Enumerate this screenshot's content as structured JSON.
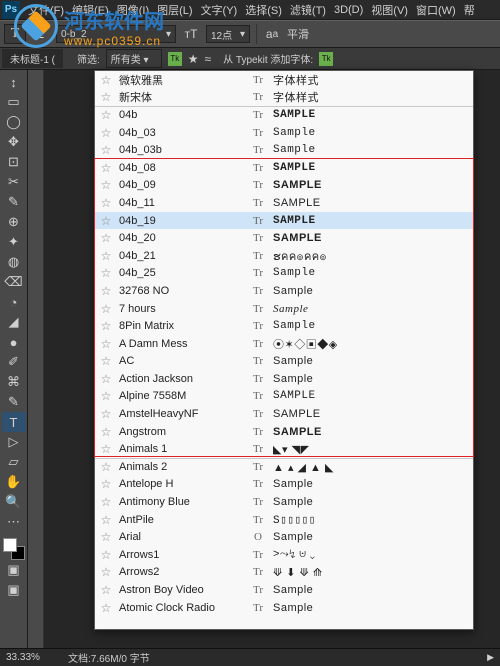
{
  "watermark": {
    "title": "河东软件网",
    "url": "www.pc0359.cn"
  },
  "menubar": {
    "logo": "Ps",
    "items": [
      "文件(F)",
      "编辑(E)",
      "图像(I)",
      "图层(L)",
      "文字(Y)",
      "选择(S)",
      "滤镜(T)",
      "3D(D)",
      "视图(V)",
      "窗口(W)",
      "帮"
    ]
  },
  "optbar": {
    "font_search": "0-b_2",
    "size_label": "12点",
    "aa_label": "平滑"
  },
  "doctab": {
    "title": "未标题-1 (",
    "filter_label": "筛选:",
    "filter_value": "所有类",
    "typekit": "从 Typekit 添加字体:"
  },
  "tools": [
    "↕",
    "▭",
    "◯",
    "✥",
    "⊡",
    "✂",
    "✎",
    "⊕",
    "✦",
    "◍",
    "⌫",
    "◔",
    "◢",
    "●",
    "✐",
    "⌘",
    "✎",
    "T",
    "▷",
    "▱",
    "✋",
    "🔍",
    "⋯"
  ],
  "font_panel": {
    "highlight_start": 5,
    "highlight_end": 22,
    "selected_index": 8,
    "rows": [
      {
        "star": "☆",
        "name": "微软雅黑",
        "type": "Tr",
        "sample": "字体样式",
        "cls": "",
        "sep": false
      },
      {
        "star": "☆",
        "name": "新宋体",
        "type": "Tr",
        "sample": "字体样式",
        "cls": "",
        "sep": false
      },
      {
        "star": "☆",
        "name": "04b",
        "type": "Tr",
        "sample": "Sample",
        "cls": "s-px",
        "sep": true
      },
      {
        "star": "☆",
        "name": "04b_03",
        "type": "Tr",
        "sample": "Sample",
        "cls": "s-mono",
        "sep": false
      },
      {
        "star": "☆",
        "name": "04b_03b",
        "type": "Tr",
        "sample": "Sample",
        "cls": "s-mono",
        "sep": false
      },
      {
        "star": "☆",
        "name": "04b_08",
        "type": "Tr",
        "sample": "SAMPLE",
        "cls": "s-px",
        "sep": false
      },
      {
        "star": "☆",
        "name": "04b_09",
        "type": "Tr",
        "sample": "SAMPLE",
        "cls": "s-block",
        "sep": false
      },
      {
        "star": "☆",
        "name": "04b_11",
        "type": "Tr",
        "sample": "sample",
        "cls": "s-wide",
        "sep": false
      },
      {
        "star": "☆",
        "name": "04b_19",
        "type": "Tr",
        "sample": "sample",
        "cls": "s-px",
        "sep": false
      },
      {
        "star": "☆",
        "name": "04b_20",
        "type": "Tr",
        "sample": "sample",
        "cls": "s-block",
        "sep": false
      },
      {
        "star": "☆",
        "name": "04b_21",
        "type": "Tr",
        "sample": "ຮคค๏คค๏",
        "cls": "",
        "sep": false
      },
      {
        "star": "☆",
        "name": "04b_25",
        "type": "Tr",
        "sample": "Sample",
        "cls": "s-mono",
        "sep": false
      },
      {
        "star": "☆",
        "name": "32768 NO",
        "type": "Tr",
        "sample": "Sample",
        "cls": "",
        "sep": false
      },
      {
        "star": "☆",
        "name": "7 hours",
        "type": "Tr",
        "sample": "Sample",
        "cls": "s-serif",
        "sep": false
      },
      {
        "star": "☆",
        "name": "8Pin Matrix",
        "type": "Tr",
        "sample": "Sample",
        "cls": "s-mono",
        "sep": false
      },
      {
        "star": "☆",
        "name": "A Damn Mess",
        "type": "Tr",
        "sample": "⦿✶◇▣◆◈",
        "cls": "s-sym",
        "sep": false
      },
      {
        "star": "☆",
        "name": "AC",
        "type": "Tr",
        "sample": "Sample",
        "cls": "",
        "sep": false
      },
      {
        "star": "☆",
        "name": "Action Jackson",
        "type": "Tr",
        "sample": "Sample",
        "cls": "",
        "sep": false
      },
      {
        "star": "☆",
        "name": "Alpine 7558M",
        "type": "Tr",
        "sample": "SAMPLE",
        "cls": "s-mono",
        "sep": false
      },
      {
        "star": "☆",
        "name": "AmstelHeavyNF",
        "type": "Tr",
        "sample": "SAMPLE",
        "cls": "s-wide",
        "sep": false
      },
      {
        "star": "☆",
        "name": "Angstrom",
        "type": "Tr",
        "sample": "SAMPLE",
        "cls": "s-bold",
        "sep": false
      },
      {
        "star": "☆",
        "name": "Animals 1",
        "type": "Tr",
        "sample": "◣▾ ◥◤",
        "cls": "s-sym",
        "sep": false
      },
      {
        "star": "☆",
        "name": "Animals 2",
        "type": "Tr",
        "sample": "▲ ▴ ◢ ▲ ◣",
        "cls": "s-sym",
        "sep": true
      },
      {
        "star": "☆",
        "name": "Antelope H",
        "type": "Tr",
        "sample": "Sample",
        "cls": "",
        "sep": false
      },
      {
        "star": "☆",
        "name": "Antimony Blue",
        "type": "Tr",
        "sample": "Sample",
        "cls": "",
        "sep": false
      },
      {
        "star": "☆",
        "name": "AntPile",
        "type": "Tr",
        "sample": "S▯▯▯▯▯",
        "cls": "s-mono",
        "sep": false
      },
      {
        "star": "☆",
        "name": "Arial",
        "type": "O",
        "sample": "Sample",
        "cls": "",
        "sep": false
      },
      {
        "star": "☆",
        "name": "Arrows1",
        "type": "Tr",
        "sample": ">⤳↯ ⊍ ⌄",
        "cls": "s-sym",
        "sep": false
      },
      {
        "star": "☆",
        "name": "Arrows2",
        "type": "Tr",
        "sample": "⟱ ⬇ ⟱ ⟰",
        "cls": "s-sym",
        "sep": false
      },
      {
        "star": "☆",
        "name": "Astron Boy Video",
        "type": "Tr",
        "sample": "Sample",
        "cls": "",
        "sep": false
      },
      {
        "star": "☆",
        "name": "Atomic Clock Radio",
        "type": "Tr",
        "sample": "Sample",
        "cls": "",
        "sep": false
      }
    ]
  },
  "status": {
    "zoom": "33.33%",
    "info": "文档:7.66M/0 字节"
  }
}
